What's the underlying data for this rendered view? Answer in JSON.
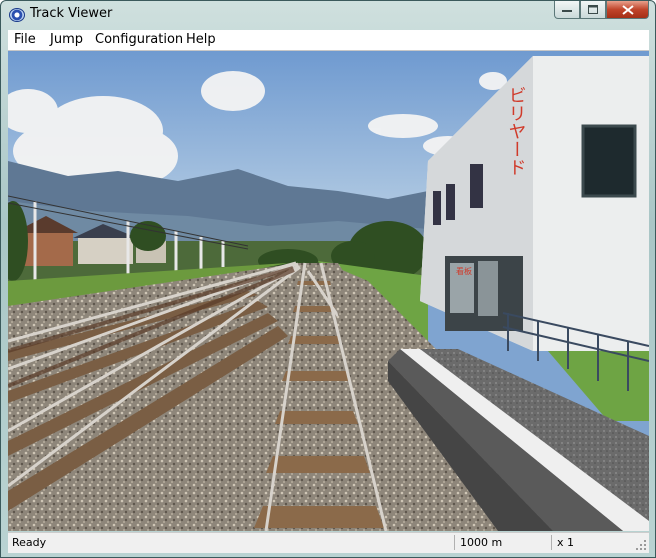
{
  "window": {
    "title": "Track Viewer",
    "app_icon": "eye-icon"
  },
  "caption_buttons": {
    "minimize": "—",
    "maximize": "☐",
    "close": "✕"
  },
  "menu": {
    "items": [
      "File",
      "Jump",
      "Configuration",
      "Help"
    ]
  },
  "scene": {
    "description_icon": "railway-3d-view",
    "sign_text": "ビリヤード"
  },
  "status": {
    "state": "Ready",
    "distance": "1000 m",
    "speed": "x 1"
  }
}
